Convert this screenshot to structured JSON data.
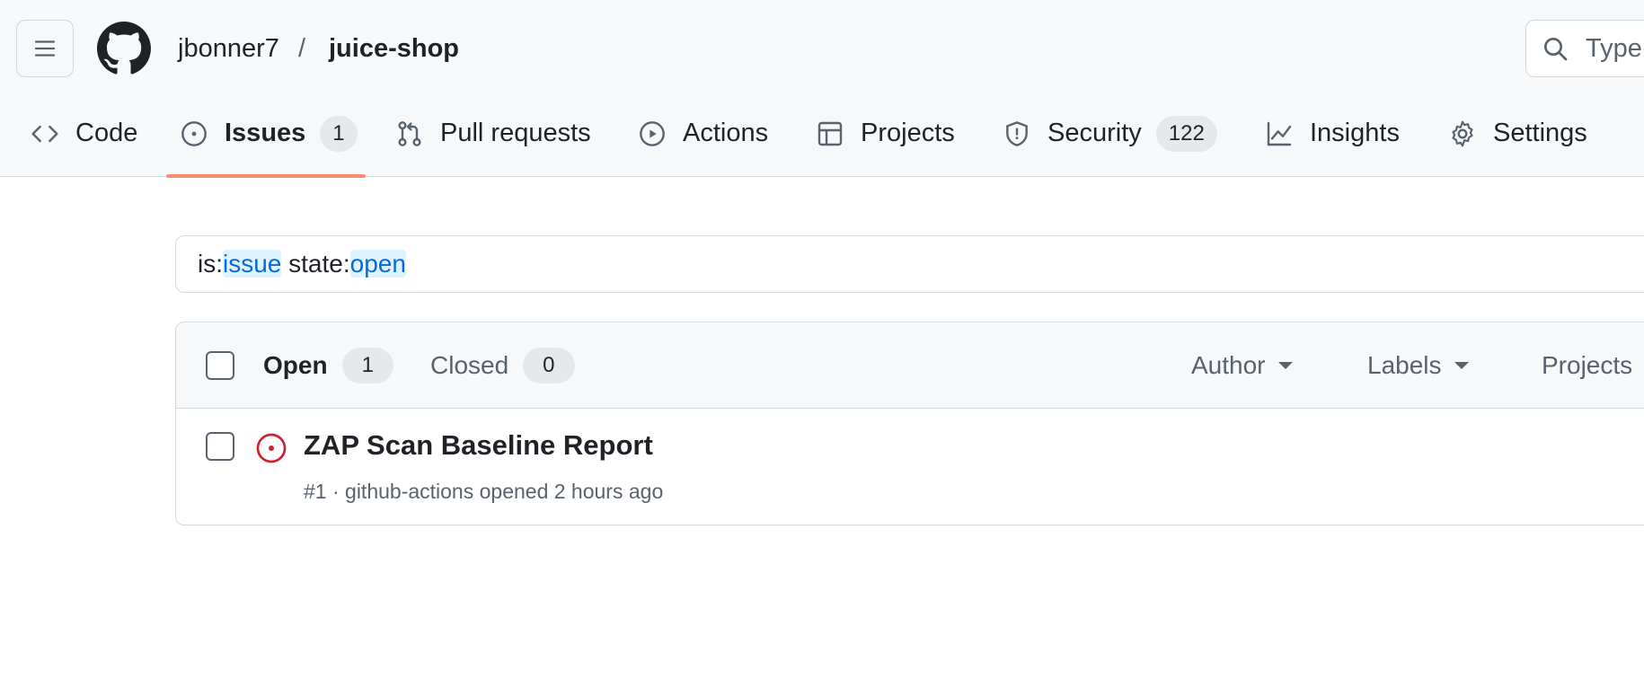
{
  "repo": {
    "owner": "jbonner7",
    "separator": "/",
    "name": "juice-shop"
  },
  "search": {
    "placeholder": "Type"
  },
  "tabs": [
    {
      "label": "Code",
      "icon": "code-icon"
    },
    {
      "label": "Issues",
      "icon": "issue-opened-icon",
      "counter": "1",
      "active": true
    },
    {
      "label": "Pull requests",
      "icon": "git-pull-request-icon"
    },
    {
      "label": "Actions",
      "icon": "play-icon"
    },
    {
      "label": "Projects",
      "icon": "table-icon"
    },
    {
      "label": "Security",
      "icon": "shield-icon",
      "counter": "122"
    },
    {
      "label": "Insights",
      "icon": "graph-icon"
    },
    {
      "label": "Settings",
      "icon": "gear-icon"
    }
  ],
  "query": {
    "part1": "is:",
    "value1": "issue",
    "part2": " state:",
    "value2": "open"
  },
  "issues": {
    "open_label": "Open",
    "open_count": "1",
    "closed_label": "Closed",
    "closed_count": "0",
    "filters": [
      "Author",
      "Labels",
      "Projects"
    ],
    "items": [
      {
        "title": "ZAP Scan Baseline Report",
        "meta": "#1 · github-actions opened 2 hours ago",
        "state_color": "#cf222e"
      }
    ]
  },
  "colors": {
    "accent_underline": "#fd8c73",
    "link_blue": "#0969da",
    "open_issue_red": "#cf222e"
  }
}
